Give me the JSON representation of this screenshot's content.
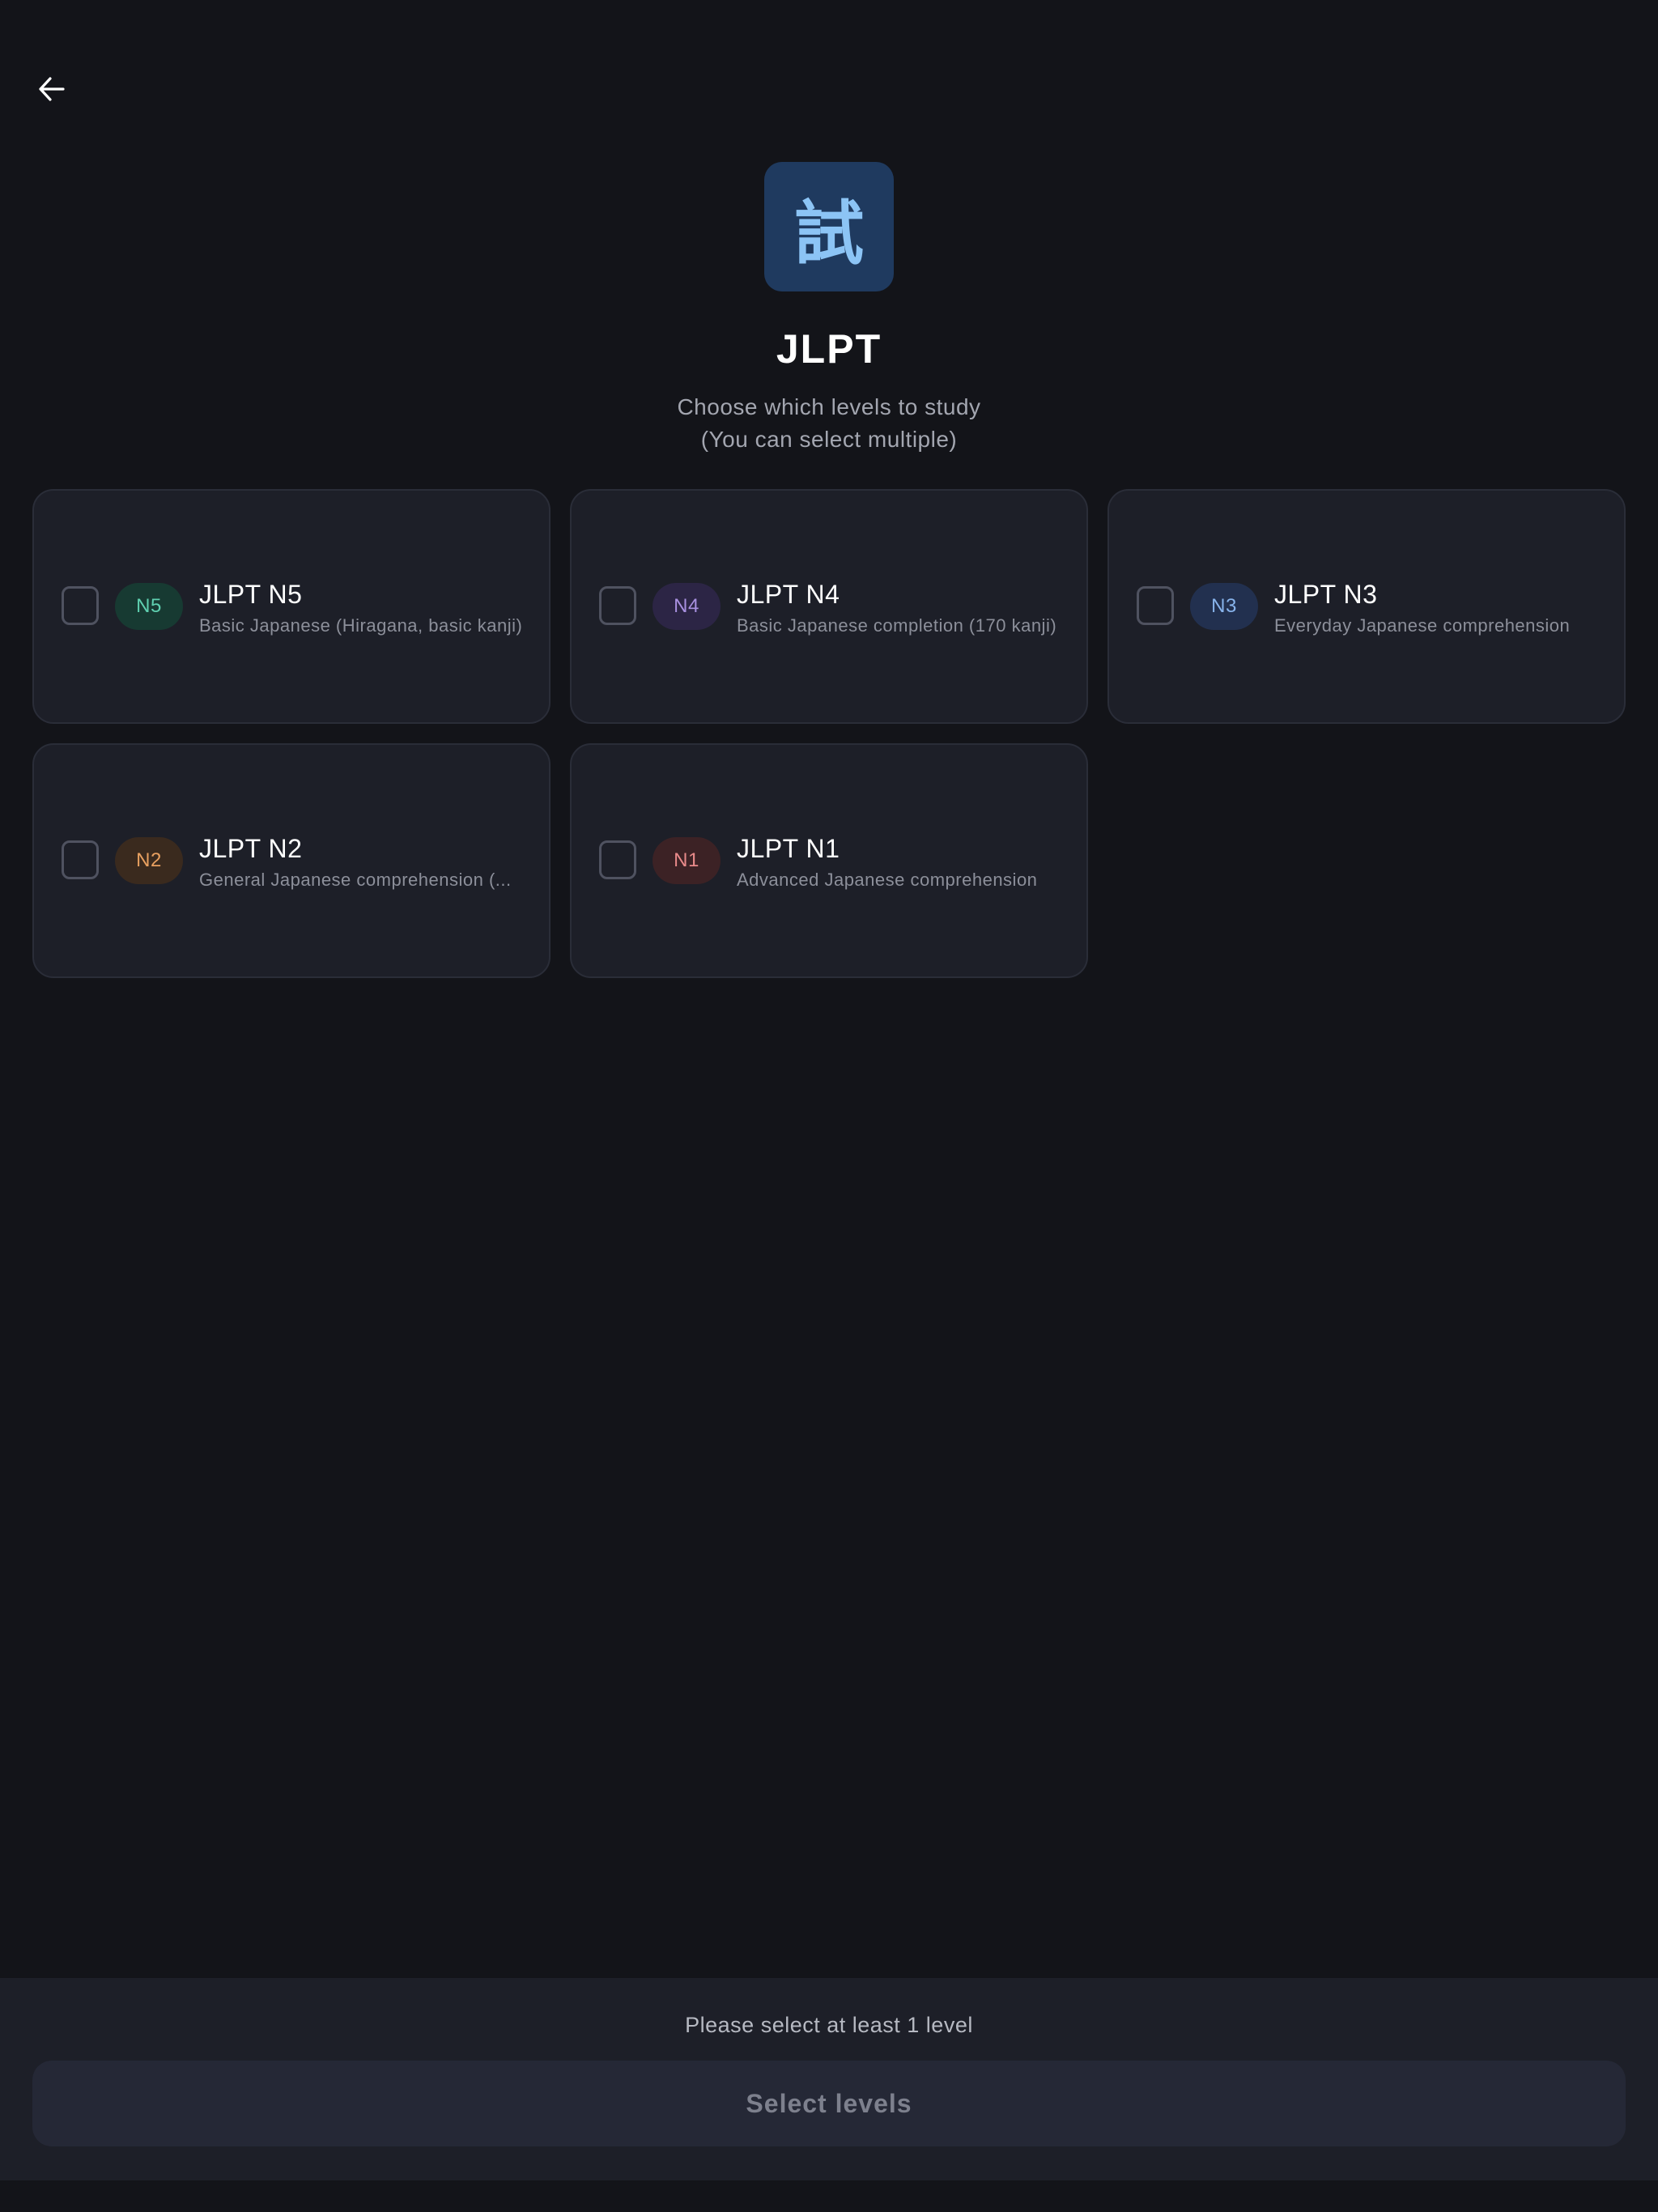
{
  "header": {
    "back_icon": "arrow-left-icon",
    "logo_glyph": "試",
    "title": "JLPT",
    "subtitle_line1": "Choose which levels to study",
    "subtitle_line2": "(You can select multiple)"
  },
  "levels": [
    {
      "badge": "N5",
      "title": "JLPT N5",
      "description": "Basic Japanese (Hiragana, basic kanji)",
      "checked": false,
      "badge_bg": "#173a32",
      "badge_fg": "#5fd0b0"
    },
    {
      "badge": "N4",
      "title": "JLPT N4",
      "description": "Basic Japanese completion (170 kanji)",
      "checked": false,
      "badge_bg": "#2c2545",
      "badge_fg": "#a890e0"
    },
    {
      "badge": "N3",
      "title": "JLPT N3",
      "description": "Everyday Japanese comprehension",
      "checked": false,
      "badge_bg": "#22304f",
      "badge_fg": "#88b4ec"
    },
    {
      "badge": "N2",
      "title": "JLPT N2",
      "description": "General Japanese comprehension (...",
      "checked": false,
      "badge_bg": "#3a2a1e",
      "badge_fg": "#e8a060"
    },
    {
      "badge": "N1",
      "title": "JLPT N1",
      "description": "Advanced Japanese comprehension",
      "checked": false,
      "badge_bg": "#3c2225",
      "badge_fg": "#e88a8a"
    }
  ],
  "footer": {
    "hint": "Please select at least 1 level",
    "button_label": "Select levels"
  },
  "colors": {
    "background": "#131419",
    "card": "#1d1f28",
    "logo_bg": "#1f3a5f",
    "logo_fg": "#8cc4f5"
  }
}
